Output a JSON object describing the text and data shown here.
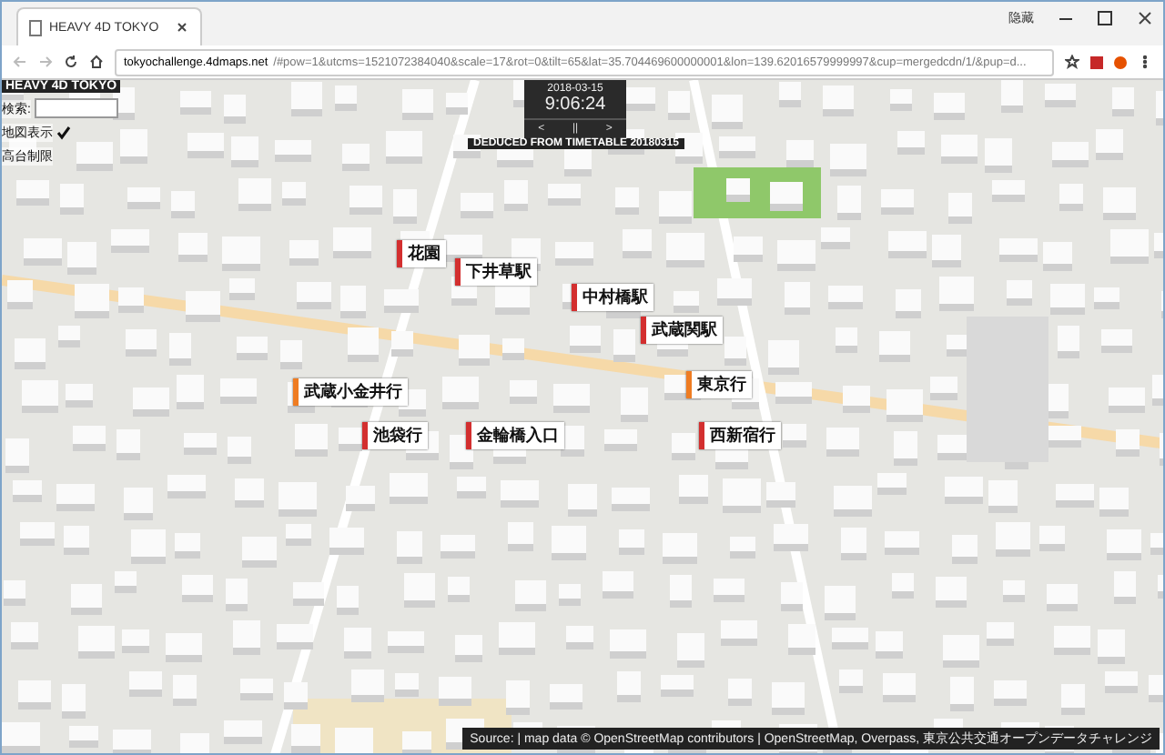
{
  "browser": {
    "tab_title": "HEAVY 4D TOKYO",
    "profile": "隐藏",
    "url_host": "tokyochallenge.4dmaps.net",
    "url_rest": "/#pow=1&utcms=1521072384040&scale=17&rot=0&tilt=65&lat=35.704469600000001&lon=139.62016579999997&cup=mergedcdn/1/&pup=d..."
  },
  "panel": {
    "title": "HEAVY 4D TOKYO",
    "search_label": "検索:",
    "map_label": "地図表示",
    "map_checked": true,
    "height_label": "高台制限"
  },
  "clock": {
    "date": "2018-03-15",
    "time": "9:06:24",
    "controls": [
      "<",
      "||",
      ">"
    ],
    "caption": "DEDUCED FROM TIMETABLE 20180315"
  },
  "trains": [
    {
      "label": "花園",
      "color": "#d32f2f"
    },
    {
      "label": "下井草駅",
      "color": "#d32f2f"
    },
    {
      "label": "中村橋駅",
      "color": "#d32f2f"
    },
    {
      "label": "武蔵関駅",
      "color": "#d32f2f"
    },
    {
      "label": "武蔵小金井行",
      "color": "#ef7c22"
    },
    {
      "label": "東京行",
      "color": "#ef7c22"
    },
    {
      "label": "池袋行",
      "color": "#d32f2f"
    },
    {
      "label": "金輪橋入口",
      "color": "#d32f2f"
    },
    {
      "label": "西新宿行",
      "color": "#d32f2f"
    }
  ],
  "attribution": "Source: | map data © OpenStreetMap contributors | OpenStreetMap, Overpass, 東京公共交通オープンデータチャレンジ"
}
